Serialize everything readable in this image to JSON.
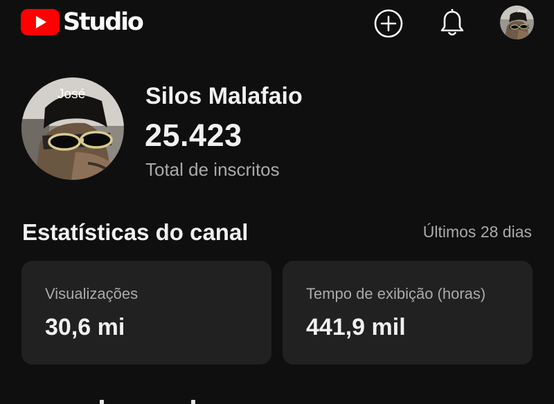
{
  "app": {
    "logo_text": "Studio",
    "brand_color": "#ff0000"
  },
  "topbar": {
    "icons": [
      "youtube-play-icon",
      "create-plus-icon",
      "notifications-bell-icon",
      "account-avatar"
    ]
  },
  "channel": {
    "name": "Silos Malafaio",
    "subscriber_count": "25.423",
    "subscriber_label": "Total de inscritos",
    "avatar_caption": "José",
    "account_avatar_caption": "José"
  },
  "stats": {
    "title": "Estatísticas do canal",
    "period": "Últimos 28 dias",
    "cards": [
      {
        "label": "Visualizações",
        "value": "30,6 mi"
      },
      {
        "label": "Tempo de exibição (horas)",
        "value": "441,9 mil"
      }
    ]
  },
  "colors": {
    "background": "#0f0f0f",
    "card": "#212121",
    "text_primary": "#f1f1f1",
    "text_secondary": "#aaaaaa"
  }
}
